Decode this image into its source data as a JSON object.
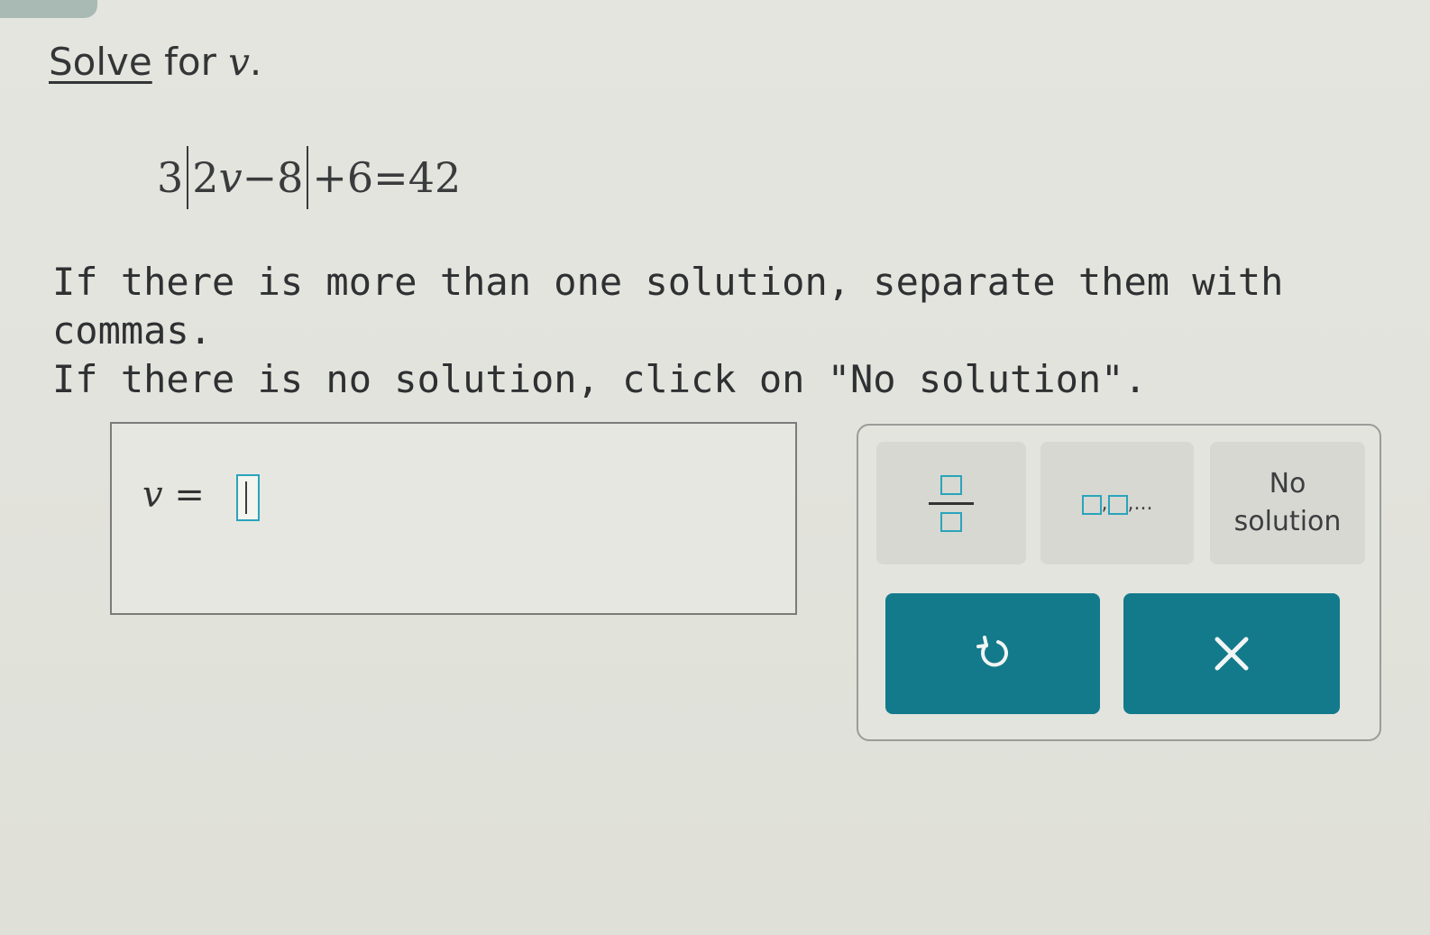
{
  "prompt": {
    "solve_link": "Solve",
    "rest": " for ",
    "variable": "v",
    "period": "."
  },
  "equation": {
    "coef": "3",
    "inner_num": "2",
    "inner_var": "v",
    "inner_rest": "−8",
    "tail": "+6=42"
  },
  "instructions": {
    "line1": "If there is more than one solution, separate them with commas.",
    "line2": "If there is no solution, click on \"No solution\"."
  },
  "answer": {
    "variable": "v",
    "equals": " =",
    "value": ""
  },
  "keypad": {
    "fraction_icon": "fraction-icon",
    "list_icon": "list-icon",
    "list_suffix": ",...",
    "no_solution_line1": "No",
    "no_solution_line2": "solution",
    "undo_icon": "undo-icon",
    "clear_icon": "clear-icon",
    "clear_glyph": "×"
  },
  "colors": {
    "accent": "#2aa4bb",
    "button": "#137a8b"
  }
}
